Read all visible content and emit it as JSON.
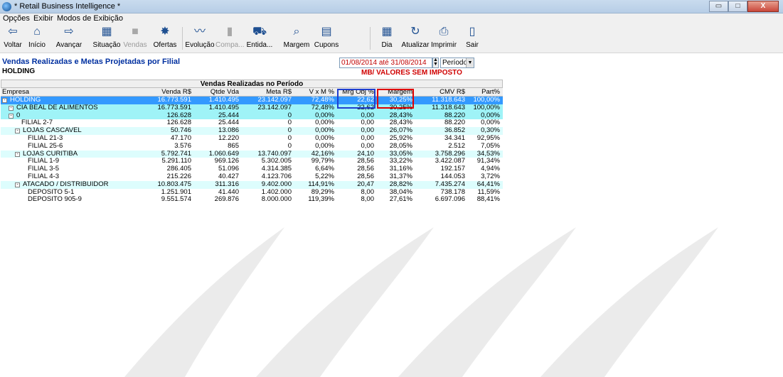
{
  "window": {
    "title": "* Retail Business Intelligence *",
    "controls": {
      "minimize": "▭",
      "maximize": "□",
      "close": "X"
    }
  },
  "menu": [
    {
      "label": "Opções"
    },
    {
      "label": "Exibir"
    },
    {
      "label": "Modos de Exibição"
    }
  ],
  "toolbar": [
    {
      "label": "Voltar",
      "icon": "arrow-left-icon",
      "glyph": "⇦",
      "enabled": true
    },
    {
      "label": "Início",
      "icon": "home-icon",
      "glyph": "⌂",
      "enabled": true
    },
    {
      "label": "Avançar",
      "icon": "arrow-right-icon",
      "glyph": "⇨",
      "enabled": true
    },
    {
      "label": "Situação",
      "icon": "situation-icon",
      "glyph": "▦",
      "enabled": true
    },
    {
      "label": "Vendas",
      "icon": "sales-icon",
      "glyph": "■",
      "enabled": false
    },
    {
      "label": "Ofertas",
      "icon": "offers-icon",
      "glyph": "✸",
      "enabled": true
    },
    {
      "label": "Evolução",
      "icon": "evolution-icon",
      "glyph": "〰",
      "enabled": true
    },
    {
      "label": "Compa...",
      "icon": "compare-icon",
      "glyph": "▮",
      "enabled": false
    },
    {
      "label": "Entida...",
      "icon": "entity-icon",
      "glyph": "⛟",
      "enabled": true
    },
    {
      "label": "Margem",
      "icon": "margin-icon",
      "glyph": "⌕",
      "enabled": true
    },
    {
      "label": "Cupons",
      "icon": "coupons-icon",
      "glyph": "▤",
      "enabled": true
    },
    {
      "label": "Dia",
      "icon": "calendar-icon",
      "glyph": "▦",
      "enabled": true
    },
    {
      "label": "Atualizar",
      "icon": "refresh-icon",
      "glyph": "↻",
      "enabled": true
    },
    {
      "label": "Imprimir",
      "icon": "printer-icon",
      "glyph": "⎙",
      "enabled": true
    },
    {
      "label": "Sair",
      "icon": "exit-icon",
      "glyph": "▯",
      "enabled": true
    }
  ],
  "header": {
    "title": "Vendas Realizadas e Metas Projetadas por Filial",
    "subtitle": "HOLDING",
    "period": "01/08/2014 até 31/08/2014",
    "period_mode": "Período",
    "mb_label": "MB/  VALORES SEM IMPOSTO"
  },
  "grid": {
    "title": "Vendas Realizadas no Período",
    "columns": [
      "Empresa",
      "Venda R$",
      "Qtde Vda",
      "Meta R$",
      "V x M %",
      "Mrg Obj %",
      "Margem",
      "CMV R$",
      "Part%"
    ],
    "rows": [
      {
        "empresa": "HOLDING",
        "level": 0,
        "toggle": "-",
        "style": "sel",
        "venda": "16.773.591",
        "qtde": "1.410.495",
        "meta": "23.142.097",
        "vxm": "72,48%",
        "mrgobj": "22,62",
        "margem": "30,25%",
        "cmv": "11.318.643",
        "part": "100,00%"
      },
      {
        "empresa": "CIA BEAL DE ALIMENTOS",
        "level": 1,
        "toggle": "-",
        "style": "cyan",
        "venda": "16.773.591",
        "qtde": "1.410.495",
        "meta": "23.142.097",
        "vxm": "72,48%",
        "mrgobj": "22,62",
        "margem": "30,25%",
        "cmv": "11.318.643",
        "part": "100,00%"
      },
      {
        "empresa": "0",
        "level": 1,
        "toggle": "-",
        "style": "cyan",
        "venda": "126.628",
        "qtde": "25.444",
        "meta": "0",
        "vxm": "0,00%",
        "mrgobj": "0,00",
        "margem": "28,43%",
        "cmv": "88.220",
        "part": "0,00%"
      },
      {
        "empresa": "FILIAL 2-7",
        "level": 3,
        "toggle": "",
        "style": "white",
        "venda": "126.628",
        "qtde": "25.444",
        "meta": "0",
        "vxm": "0,00%",
        "mrgobj": "0,00",
        "margem": "28,43%",
        "cmv": "88.220",
        "part": "0,00%"
      },
      {
        "empresa": "LOJAS CASCAVEL",
        "level": 2,
        "toggle": "-",
        "style": "lcyan",
        "venda": "50.746",
        "qtde": "13.086",
        "meta": "0",
        "vxm": "0,00%",
        "mrgobj": "0,00",
        "margem": "26,07%",
        "cmv": "36.852",
        "part": "0,30%"
      },
      {
        "empresa": "FILIAL 21-3",
        "level": 4,
        "toggle": "",
        "style": "white",
        "venda": "47.170",
        "qtde": "12.220",
        "meta": "0",
        "vxm": "0,00%",
        "mrgobj": "0,00",
        "margem": "25,92%",
        "cmv": "34.341",
        "part": "92,95%"
      },
      {
        "empresa": "FILIAL 25-6",
        "level": 4,
        "toggle": "",
        "style": "white",
        "venda": "3.576",
        "qtde": "865",
        "meta": "0",
        "vxm": "0,00%",
        "mrgobj": "0,00",
        "margem": "28,05%",
        "cmv": "2.512",
        "part": "7,05%"
      },
      {
        "empresa": "LOJAS CURITIBA",
        "level": 2,
        "toggle": "-",
        "style": "lcyan",
        "venda": "5.792.741",
        "qtde": "1.060.649",
        "meta": "13.740.097",
        "vxm": "42,16%",
        "mrgobj": "24,10",
        "margem": "33,05%",
        "cmv": "3.758.296",
        "part": "34,53%"
      },
      {
        "empresa": "FILIAL 1-9",
        "level": 4,
        "toggle": "",
        "style": "white",
        "venda": "5.291.110",
        "qtde": "969.126",
        "meta": "5.302.005",
        "vxm": "99,79%",
        "mrgobj": "28,56",
        "margem": "33,22%",
        "cmv": "3.422.087",
        "part": "91,34%"
      },
      {
        "empresa": "FILIAL 3-5",
        "level": 4,
        "toggle": "",
        "style": "white",
        "venda": "286.405",
        "qtde": "51.096",
        "meta": "4.314.385",
        "vxm": "6,64%",
        "mrgobj": "28,56",
        "margem": "31,16%",
        "cmv": "192.157",
        "part": "4,94%"
      },
      {
        "empresa": "FILIAL 4-3",
        "level": 4,
        "toggle": "",
        "style": "white",
        "venda": "215.226",
        "qtde": "40.427",
        "meta": "4.123.706",
        "vxm": "5,22%",
        "mrgobj": "28,56",
        "margem": "31,37%",
        "cmv": "144.053",
        "part": "3,72%"
      },
      {
        "empresa": "ATACADO / DISTRIBUIDOR",
        "level": 2,
        "toggle": "-",
        "style": "lcyan",
        "venda": "10.803.475",
        "qtde": "311.316",
        "meta": "9.402.000",
        "vxm": "114,91%",
        "mrgobj": "20,47",
        "margem": "28,82%",
        "cmv": "7.435.274",
        "part": "64,41%"
      },
      {
        "empresa": "DEPOSITO 5-1",
        "level": 4,
        "toggle": "",
        "style": "white",
        "venda": "1.251.901",
        "qtde": "41.440",
        "meta": "1.402.000",
        "vxm": "89,29%",
        "mrgobj": "8,00",
        "margem": "38,04%",
        "cmv": "738.178",
        "part": "11,59%"
      },
      {
        "empresa": "DEPOSITO 905-9",
        "level": 4,
        "toggle": "",
        "style": "white",
        "venda": "9.551.574",
        "qtde": "269.876",
        "meta": "8.000.000",
        "vxm": "119,39%",
        "mrgobj": "8,00",
        "margem": "27,61%",
        "cmv": "6.697.096",
        "part": "88,41%"
      }
    ]
  },
  "colors": {
    "selected_row": "#3399ff",
    "group_row": "#9ff3f7",
    "subgroup_row": "#ddfdfd",
    "title_blue": "#0030a0",
    "accent_red": "#d00000"
  }
}
